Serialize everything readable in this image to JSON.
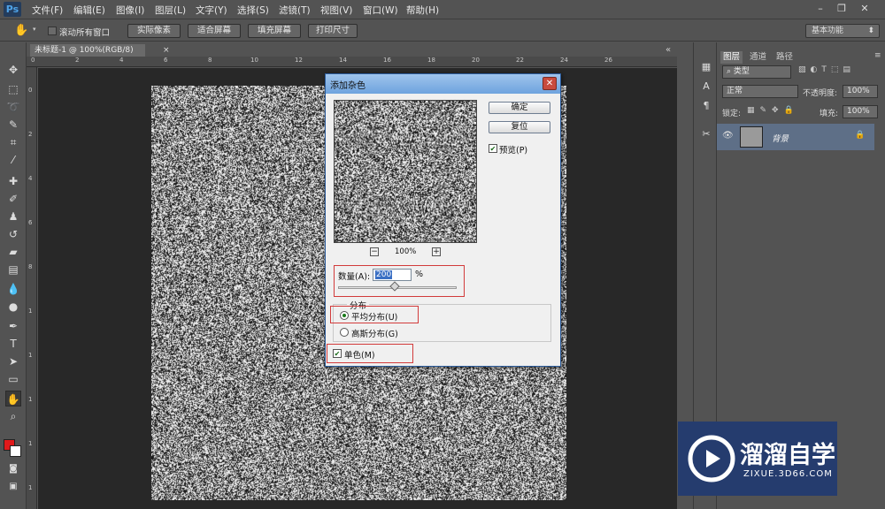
{
  "app": {
    "logo": "Ps"
  },
  "menu": [
    "文件(F)",
    "编辑(E)",
    "图像(I)",
    "图层(L)",
    "文字(Y)",
    "选择(S)",
    "滤镜(T)",
    "视图(V)",
    "窗口(W)",
    "帮助(H)"
  ],
  "options_bar": {
    "scroll_all_label": "滚动所有窗口",
    "buttons": [
      "实际像素",
      "适合屏幕",
      "填充屏幕",
      "打印尺寸"
    ],
    "workspace": "基本功能"
  },
  "document": {
    "tab_title": "未标题-1 @ 100%(RGB/8)",
    "ruler_top": [
      "0",
      "2",
      "4",
      "6",
      "8",
      "10",
      "12",
      "14",
      "16",
      "18",
      "20",
      "22",
      "24",
      "26"
    ],
    "ruler_left": [
      "0",
      "2",
      "4",
      "6",
      "8",
      "1",
      "1",
      "1",
      "1",
      "1"
    ]
  },
  "dialog": {
    "title": "添加杂色",
    "ok_label": "确定",
    "reset_label": "复位",
    "preview_label": "预览(P)",
    "preview_checked": true,
    "zoom_level": "100%",
    "zoom_out": "−",
    "zoom_in": "+",
    "amount_label": "数量(A):",
    "amount_value": "200",
    "amount_unit": "%",
    "distribution_label": "分布",
    "uniform_label": "平均分布(U)",
    "gaussian_label": "高斯分布(G)",
    "selected_distribution": "uniform",
    "mono_label": "单色(M)",
    "mono_checked": true
  },
  "layers_panel": {
    "tabs": [
      "图层",
      "通道",
      "路径"
    ],
    "kind_filter": "类型",
    "blend_mode": "正常",
    "opacity_label": "不透明度:",
    "opacity_value": "100%",
    "lock_label": "锁定:",
    "fill_label": "填充:",
    "fill_value": "100%",
    "layer_name": "背景"
  },
  "watermark": {
    "brand": "溜溜自学",
    "url": "ZIXUE.3D66.COM"
  },
  "colors": {
    "foreground": "#e0191b",
    "background": "#ffffff",
    "dialog_title": "#7eaee4",
    "highlight_box": "#d23b3b"
  }
}
